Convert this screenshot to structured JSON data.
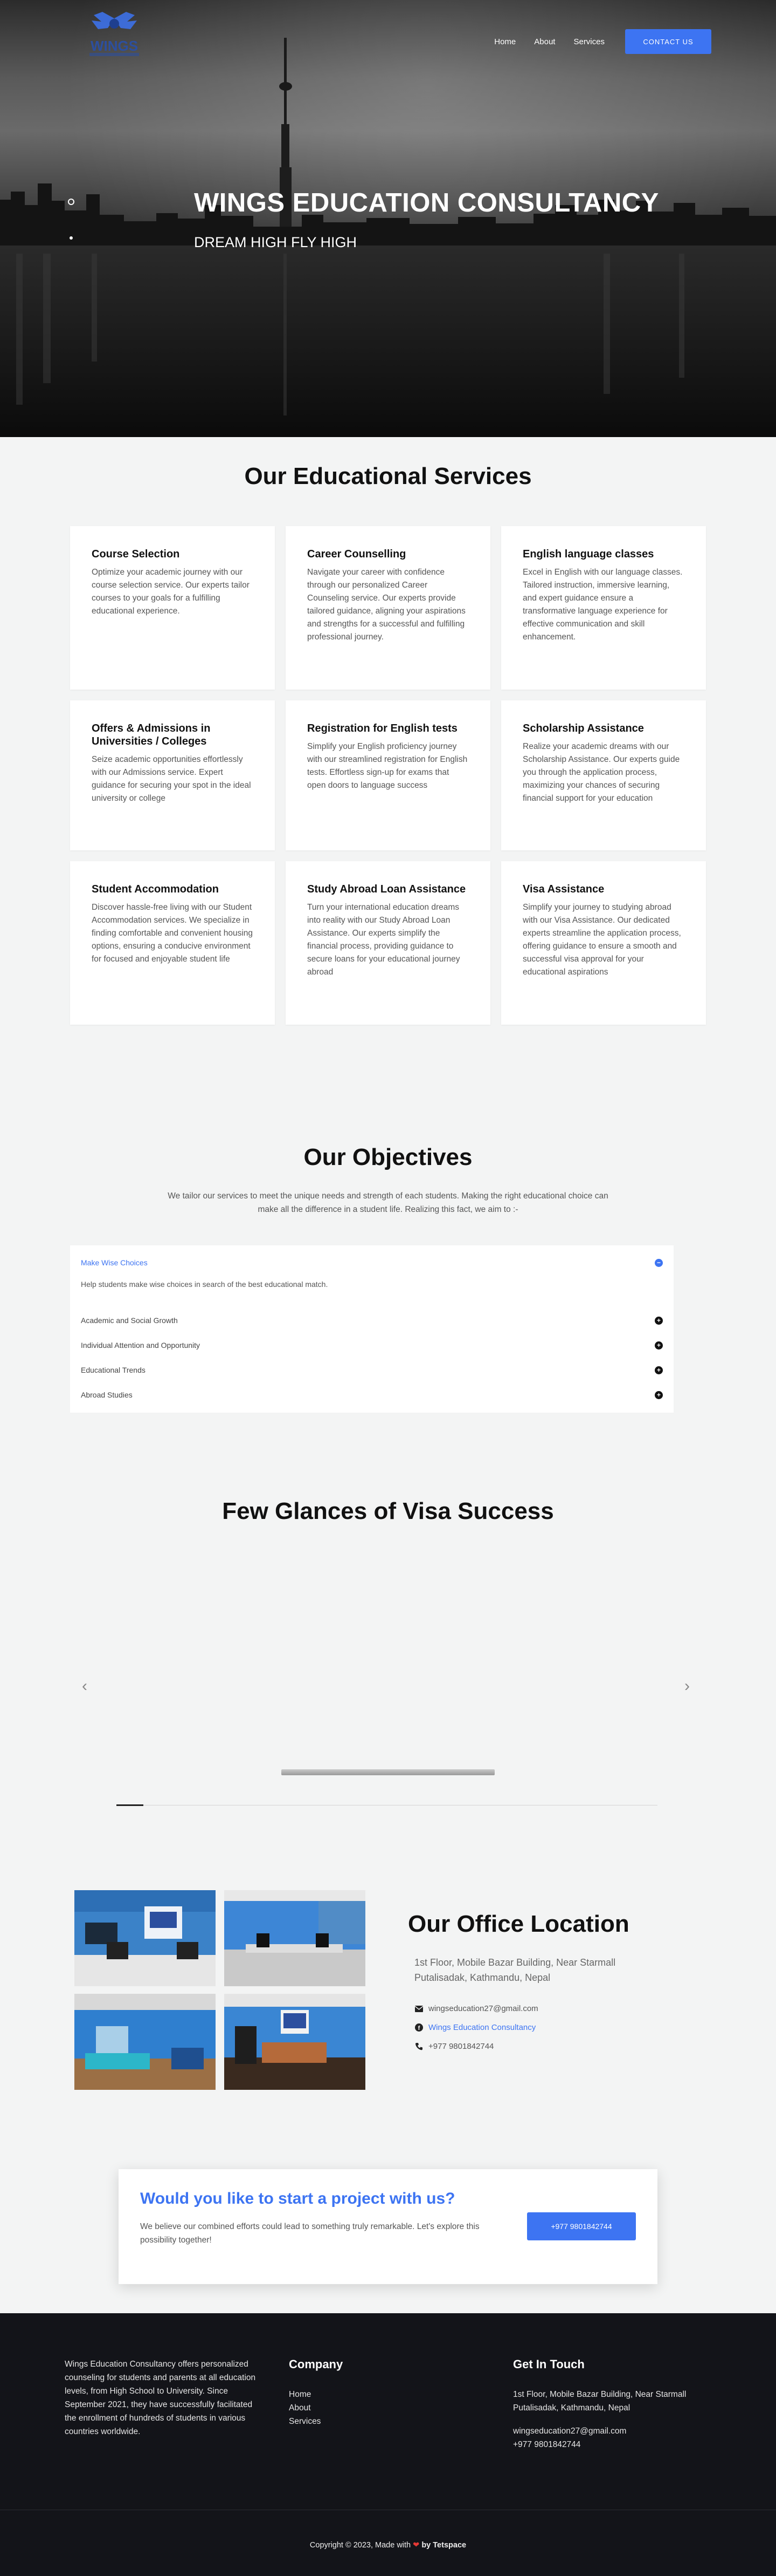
{
  "header": {
    "logo_text": "WINGS",
    "nav": [
      {
        "label": "Home"
      },
      {
        "label": "About"
      },
      {
        "label": "Services"
      }
    ],
    "contact_button": "CONTACT US"
  },
  "hero": {
    "title": "WINGS EDUCATION CONSULTANCY",
    "subtitle": "DREAM HIGH FLY HIGH"
  },
  "services": {
    "title": "Our Educational Services",
    "cards": [
      {
        "title": "Course Selection",
        "text": "Optimize your academic journey with our course selection service. Our experts tailor courses to your goals for a fulfilling educational experience."
      },
      {
        "title": "Career Counselling",
        "text": "Navigate your career with confidence through our personalized Career Counseling service. Our experts provide tailored guidance, aligning your aspirations and strengths for a successful and fulfilling professional journey."
      },
      {
        "title": "English language classes",
        "text": "Excel in English with our language classes. Tailored instruction, immersive learning, and expert guidance ensure a transformative language experience for effective communication and skill enhancement."
      },
      {
        "title": "Offers & Admissions in Universities / Colleges",
        "text": "Seize academic opportunities effortlessly with our Admissions service. Expert guidance for securing your spot in the ideal university or college"
      },
      {
        "title": "Registration for English tests",
        "text": "Simplify your English proficiency journey with our streamlined registration for English tests. Effortless sign-up for exams that open doors to language success"
      },
      {
        "title": "Scholarship Assistance",
        "text": "Realize your academic dreams with our Scholarship Assistance. Our experts guide you through the application process, maximizing your chances of securing financial support for your education"
      },
      {
        "title": "Student Accommodation",
        "text": "Discover hassle-free living with our Student Accommodation services. We specialize in finding comfortable and convenient housing options, ensuring a conducive environment for focused and enjoyable student life"
      },
      {
        "title": "Study Abroad Loan Assistance",
        "text": "Turn your international education dreams into reality with our Study Abroad Loan Assistance. Our experts simplify the financial process, providing guidance to secure loans for your educational journey abroad"
      },
      {
        "title": "Visa Assistance",
        "text": "Simplify your journey to studying abroad with our Visa Assistance. Our dedicated experts streamline the application process, offering guidance to ensure a smooth and successful visa approval for your educational aspirations"
      }
    ]
  },
  "objectives": {
    "title": "Our Objectives",
    "subtitle": "We tailor our services to meet the unique needs and strength of each students. Making the right educational choice can make all the difference in a student life. Realizing this fact, we aim to :-",
    "open_item": {
      "title": "Make Wise Choices",
      "body": "Help students make wise choices in search of the best educational match.",
      "icon": "minus-circle-icon"
    },
    "items": [
      {
        "title": "Academic and Social Growth",
        "icon": "plus-circle-icon"
      },
      {
        "title": "Individual Attention and Opportunity",
        "icon": "plus-circle-icon"
      },
      {
        "title": "Educational Trends",
        "icon": "plus-circle-icon"
      },
      {
        "title": "Abroad Studies",
        "icon": "plus-circle-icon"
      }
    ]
  },
  "visa": {
    "title": "Few Glances of Visa Success",
    "prev_icon": "chevron-left-icon",
    "next_icon": "chevron-right-icon",
    "progress": 0.05
  },
  "office": {
    "title": "Our Office Location",
    "address": "1st Floor, Mobile Bazar Building, Near Starmall Putalisadak, Kathmandu, Nepal",
    "email": "wingseducation27@gmail.com",
    "facebook": "Wings Education Consultancy",
    "phone": "+977 9801842744"
  },
  "project": {
    "title": "Would you like to start a project with us?",
    "text": "We believe our combined efforts could lead to something truly remarkable. Let's explore this possibility together!",
    "button": "+977 9801842744"
  },
  "footer": {
    "about": "Wings Education Consultancy offers personalized counseling for students and parents at all education levels, from High School to University. Since September 2021, they have successfully facilitated the enrollment of hundreds of students in various countries worldwide.",
    "company_title": "Company",
    "company_links": [
      "Home",
      "About",
      "Services"
    ],
    "getin_title": "Get In Touch",
    "address": "1st Floor, Mobile Bazar Building, Near Starmall Putalisadak, Kathmandu, Nepal",
    "email": "wingseducation27@gmail.com",
    "phone": "+977 9801842744",
    "copyright_prefix": "Copyright © 2023, Made with",
    "copyright_by": "by Tetspace"
  },
  "colors": {
    "accent": "#3d74f2",
    "footer_bg": "#131419",
    "page_bg": "#f3f4f4"
  }
}
